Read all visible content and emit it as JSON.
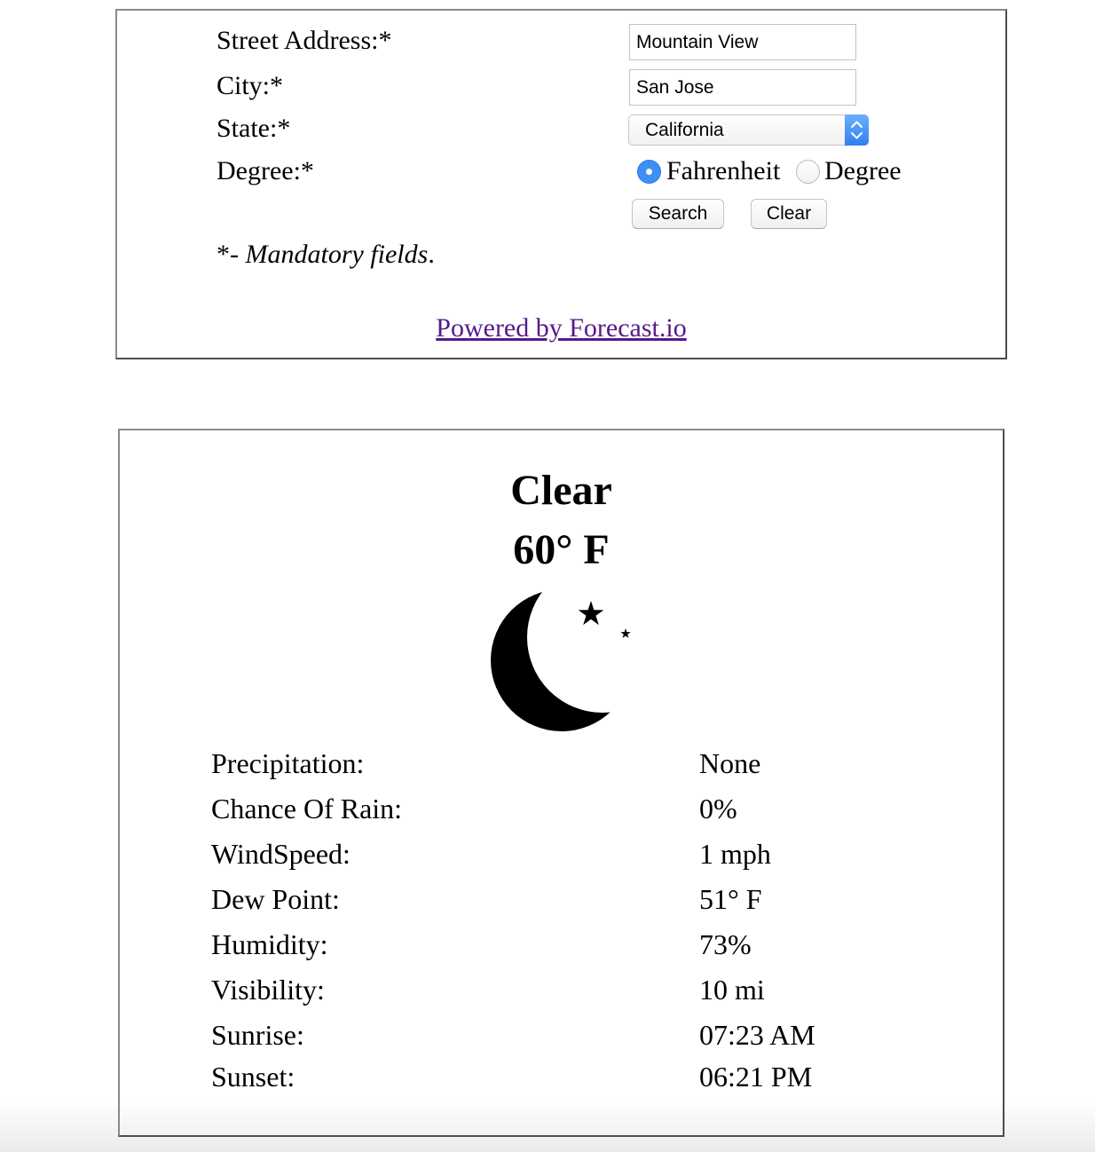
{
  "form": {
    "street_label": "Street Address:*",
    "street_value": "Mountain View",
    "city_label": "City:*",
    "city_value": "San Jose",
    "state_label": "State:*",
    "state_value": "California",
    "degree_label": "Degree:*",
    "degree_options": [
      {
        "label": "Fahrenheit",
        "selected": true
      },
      {
        "label": "Degree",
        "selected": false
      }
    ],
    "search_label": "Search",
    "clear_label": "Clear",
    "mandatory_prefix": "*- ",
    "mandatory_text": "Mandatory fields",
    "mandatory_suffix": ".",
    "powered_by": "Powered by Forecast.io"
  },
  "weather": {
    "summary": "Clear",
    "temperature": "60° F",
    "icon": "clear-night-moon-stars-icon",
    "details": [
      {
        "label": "Precipitation:",
        "value": "None"
      },
      {
        "label": "Chance Of Rain:",
        "value": "0%"
      },
      {
        "label": "WindSpeed:",
        "value": "1 mph"
      },
      {
        "label": "Dew Point:",
        "value": "51° F"
      },
      {
        "label": "Humidity:",
        "value": "73%"
      },
      {
        "label": "Visibility:",
        "value": "10 mi"
      },
      {
        "label": "Sunrise:",
        "value": "07:23 AM"
      },
      {
        "label": "Sunset:",
        "value": "06:21 PM"
      }
    ]
  },
  "colors": {
    "link": "#551a8b",
    "radio_selected": "#3d8ff5",
    "select_arrow": "#2f7ff0",
    "panel_border": "#4d4d4d"
  }
}
